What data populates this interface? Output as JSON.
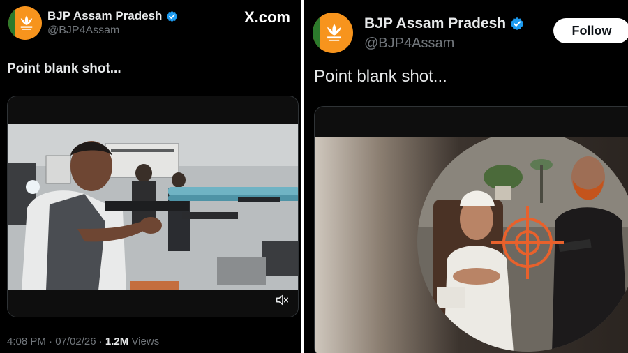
{
  "left": {
    "account_name": "BJP Assam Pradesh",
    "handle": "@BJP4Assam",
    "site_label": "X.com",
    "post_text": "Point blank shot...",
    "timestamp": "4:08 PM · 07/02/26 · ",
    "views_count": "1.2M",
    "views_label": " Views",
    "video_muted_icon": "speaker-muted-icon"
  },
  "right": {
    "account_name": "BJP Assam Pradesh",
    "handle": "@BJP4Assam",
    "follow_label": "Follow",
    "post_text": "Point blank shot..."
  },
  "colors": {
    "background": "#000000",
    "verified_blue": "#1d9bf0",
    "bjp_saffron": "#f7941d",
    "bjp_green": "#2c7a2c",
    "crosshair": "#e8612c"
  }
}
